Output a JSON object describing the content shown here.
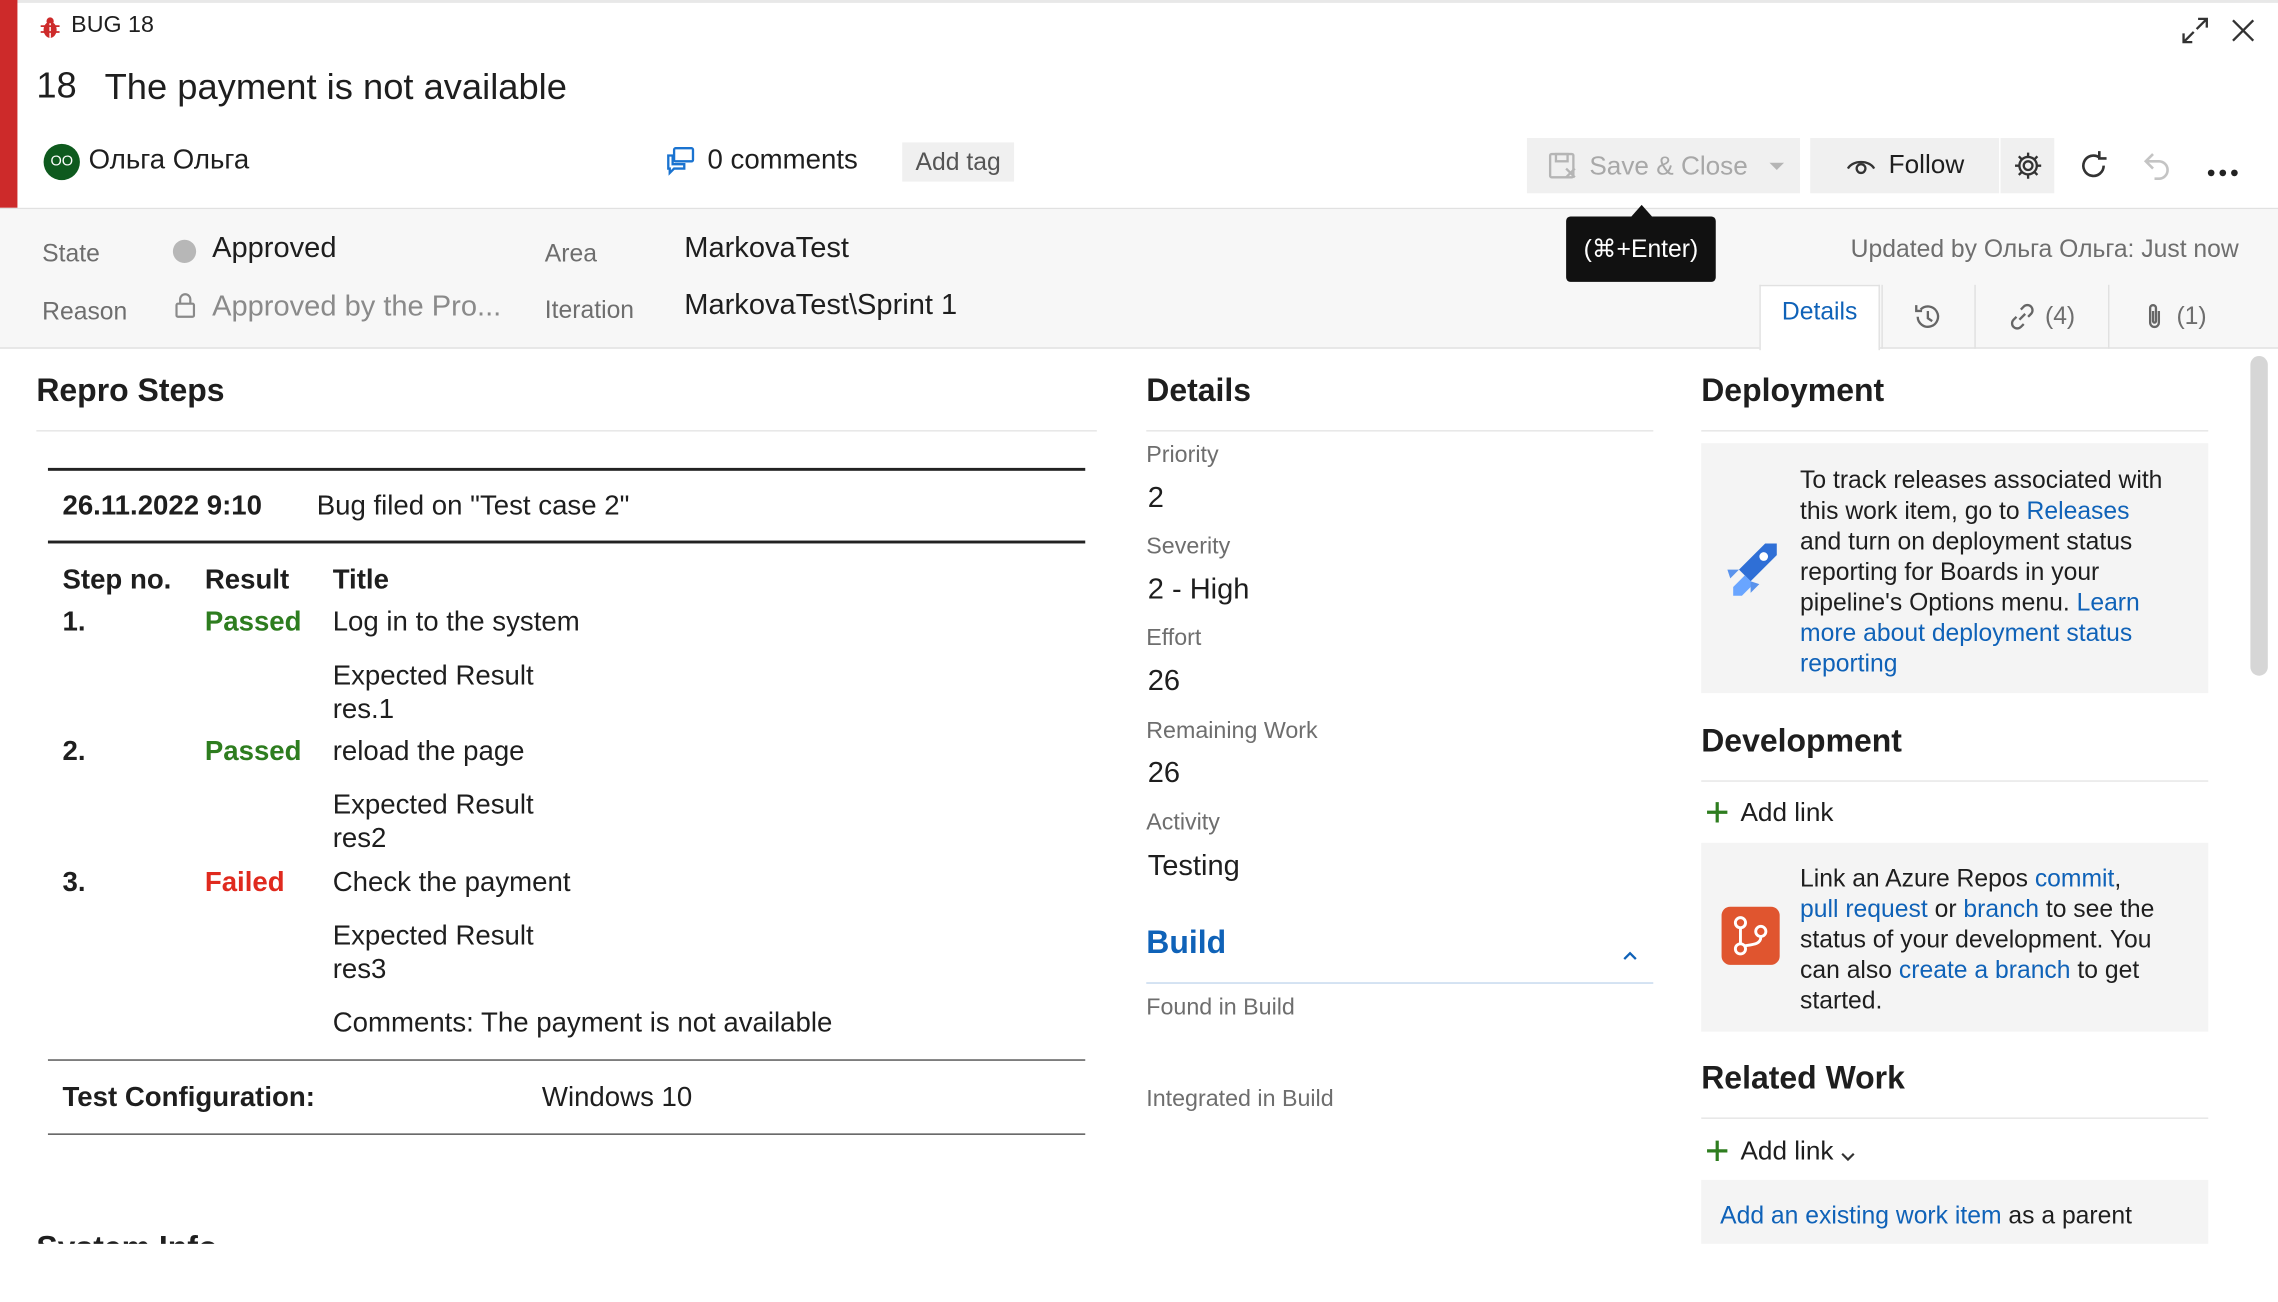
{
  "header": {
    "type_label": "BUG 18",
    "id": "18",
    "title": "The payment is not available",
    "avatar_initials": "OO",
    "assigned_to": "Ольга Ольга",
    "comments": "0 comments",
    "add_tag": "Add tag",
    "save_close": "Save & Close",
    "follow": "Follow",
    "tooltip": "(⌘+Enter)",
    "updated_by": "Updated by Ольга Ольга: Just now"
  },
  "meta": {
    "state_label": "State",
    "state_value": "Approved",
    "reason_label": "Reason",
    "reason_value": "Approved by the Pro...",
    "area_label": "Area",
    "area_value": "MarkovaTest",
    "iteration_label": "Iteration",
    "iteration_value": "MarkovaTest\\Sprint 1"
  },
  "tabs": {
    "details": "Details",
    "links": "(4)",
    "attachments": "(1)"
  },
  "repro": {
    "title": "Repro Steps",
    "datetime": "26.11.2022 9:10",
    "filed": "Bug filed on \"Test case 2\"",
    "col_step": "Step no.",
    "col_result": "Result",
    "col_title": "Title",
    "steps": [
      {
        "no": "1.",
        "result": "Passed",
        "title": "Log in to the system",
        "expected_label": "Expected Result",
        "expected": "res.1"
      },
      {
        "no": "2.",
        "result": "Passed",
        "title": "reload the page",
        "expected_label": "Expected Result",
        "expected": "res2"
      },
      {
        "no": "3.",
        "result": "Failed",
        "title": "Check the payment",
        "expected_label": "Expected Result",
        "expected": "res3"
      }
    ],
    "comments": "Comments: The payment is not available",
    "config_label": "Test Configuration:",
    "config_value": "Windows 10",
    "next_section": "System Info"
  },
  "details": {
    "title": "Details",
    "priority_label": "Priority",
    "priority": "2",
    "severity_label": "Severity",
    "severity": "2 - High",
    "effort_label": "Effort",
    "effort": "26",
    "remaining_label": "Remaining Work",
    "remaining": "26",
    "activity_label": "Activity",
    "activity": "Testing",
    "build_title": "Build",
    "found_label": "Found in Build",
    "integrated_label": "Integrated in Build"
  },
  "deployment": {
    "title": "Deployment",
    "t1": "To track releases associated with",
    "t2": "this work item, go to",
    "releases": "Releases",
    "t3": "and turn on deployment status",
    "t4": "reporting for Boards in your",
    "t5": "pipeline's Options menu.",
    "learn1": "Learn",
    "learn2": "more about deployment status",
    "learn3": "reporting"
  },
  "development": {
    "title": "Development",
    "add_link": "Add link",
    "t1": "Link an Azure Repos",
    "commit": "commit",
    "pull_request": "pull request",
    "or": "or",
    "branch": "branch",
    "t2": "to see the",
    "t3": "status of your development. You",
    "t4": "can also",
    "create_branch": "create a branch",
    "t5": "to get",
    "t6": "started."
  },
  "related": {
    "title": "Related Work",
    "add_link": "Add link",
    "existing": "Add an existing work item",
    "as_parent": "as a parent"
  },
  "colors": {
    "bug_red": "#cd2a2a",
    "link_blue": "#0f62b8",
    "passed": "#2e7d1f",
    "failed": "#e02a1e",
    "avatar": "#0e5a1e"
  }
}
